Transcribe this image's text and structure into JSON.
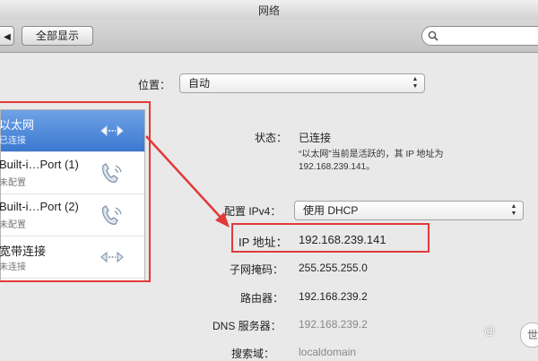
{
  "window": {
    "title": "网络"
  },
  "toolbar": {
    "show_all_label": "全部显示",
    "back_label": "◀"
  },
  "location": {
    "label": "位置：",
    "value": "自动"
  },
  "services": [
    {
      "name": "以太网",
      "status": "已连接",
      "icon": "ethernet-arrows-icon",
      "selected": true
    },
    {
      "name": "Built-i…Port (1)",
      "status": "未配置",
      "icon": "phone-modem-icon",
      "selected": false
    },
    {
      "name": "Built-i…Port (2)",
      "status": "未配置",
      "icon": "phone-modem-icon",
      "selected": false
    },
    {
      "name": "宽带连接",
      "status": "未连接",
      "icon": "ethernet-arrows-icon",
      "selected": false
    }
  ],
  "detail": {
    "status_label": "状态：",
    "status_value": "已连接",
    "status_desc_line1": "“以太网”当前是活跃的，其 IP 地址为",
    "status_desc_line2": "192.168.239.141。",
    "ipv4_label": "配置 IPv4：",
    "ipv4_value": "使用 DHCP",
    "ip_label": "IP 地址：",
    "ip_value": "192.168.239.141",
    "mask_label": "子网掩码：",
    "mask_value": "255.255.255.0",
    "router_label": "路由器：",
    "router_value": "192.168.239.2",
    "dns_label": "DNS 服务器：",
    "dns_value": "192.168.239.2",
    "search_label": "搜索域：",
    "search_value": "localdomain"
  },
  "watermark": {
    "text": "@",
    "circle": "世"
  },
  "colors": {
    "selection": "#3a78d0",
    "annotation": "#e23a3a"
  }
}
